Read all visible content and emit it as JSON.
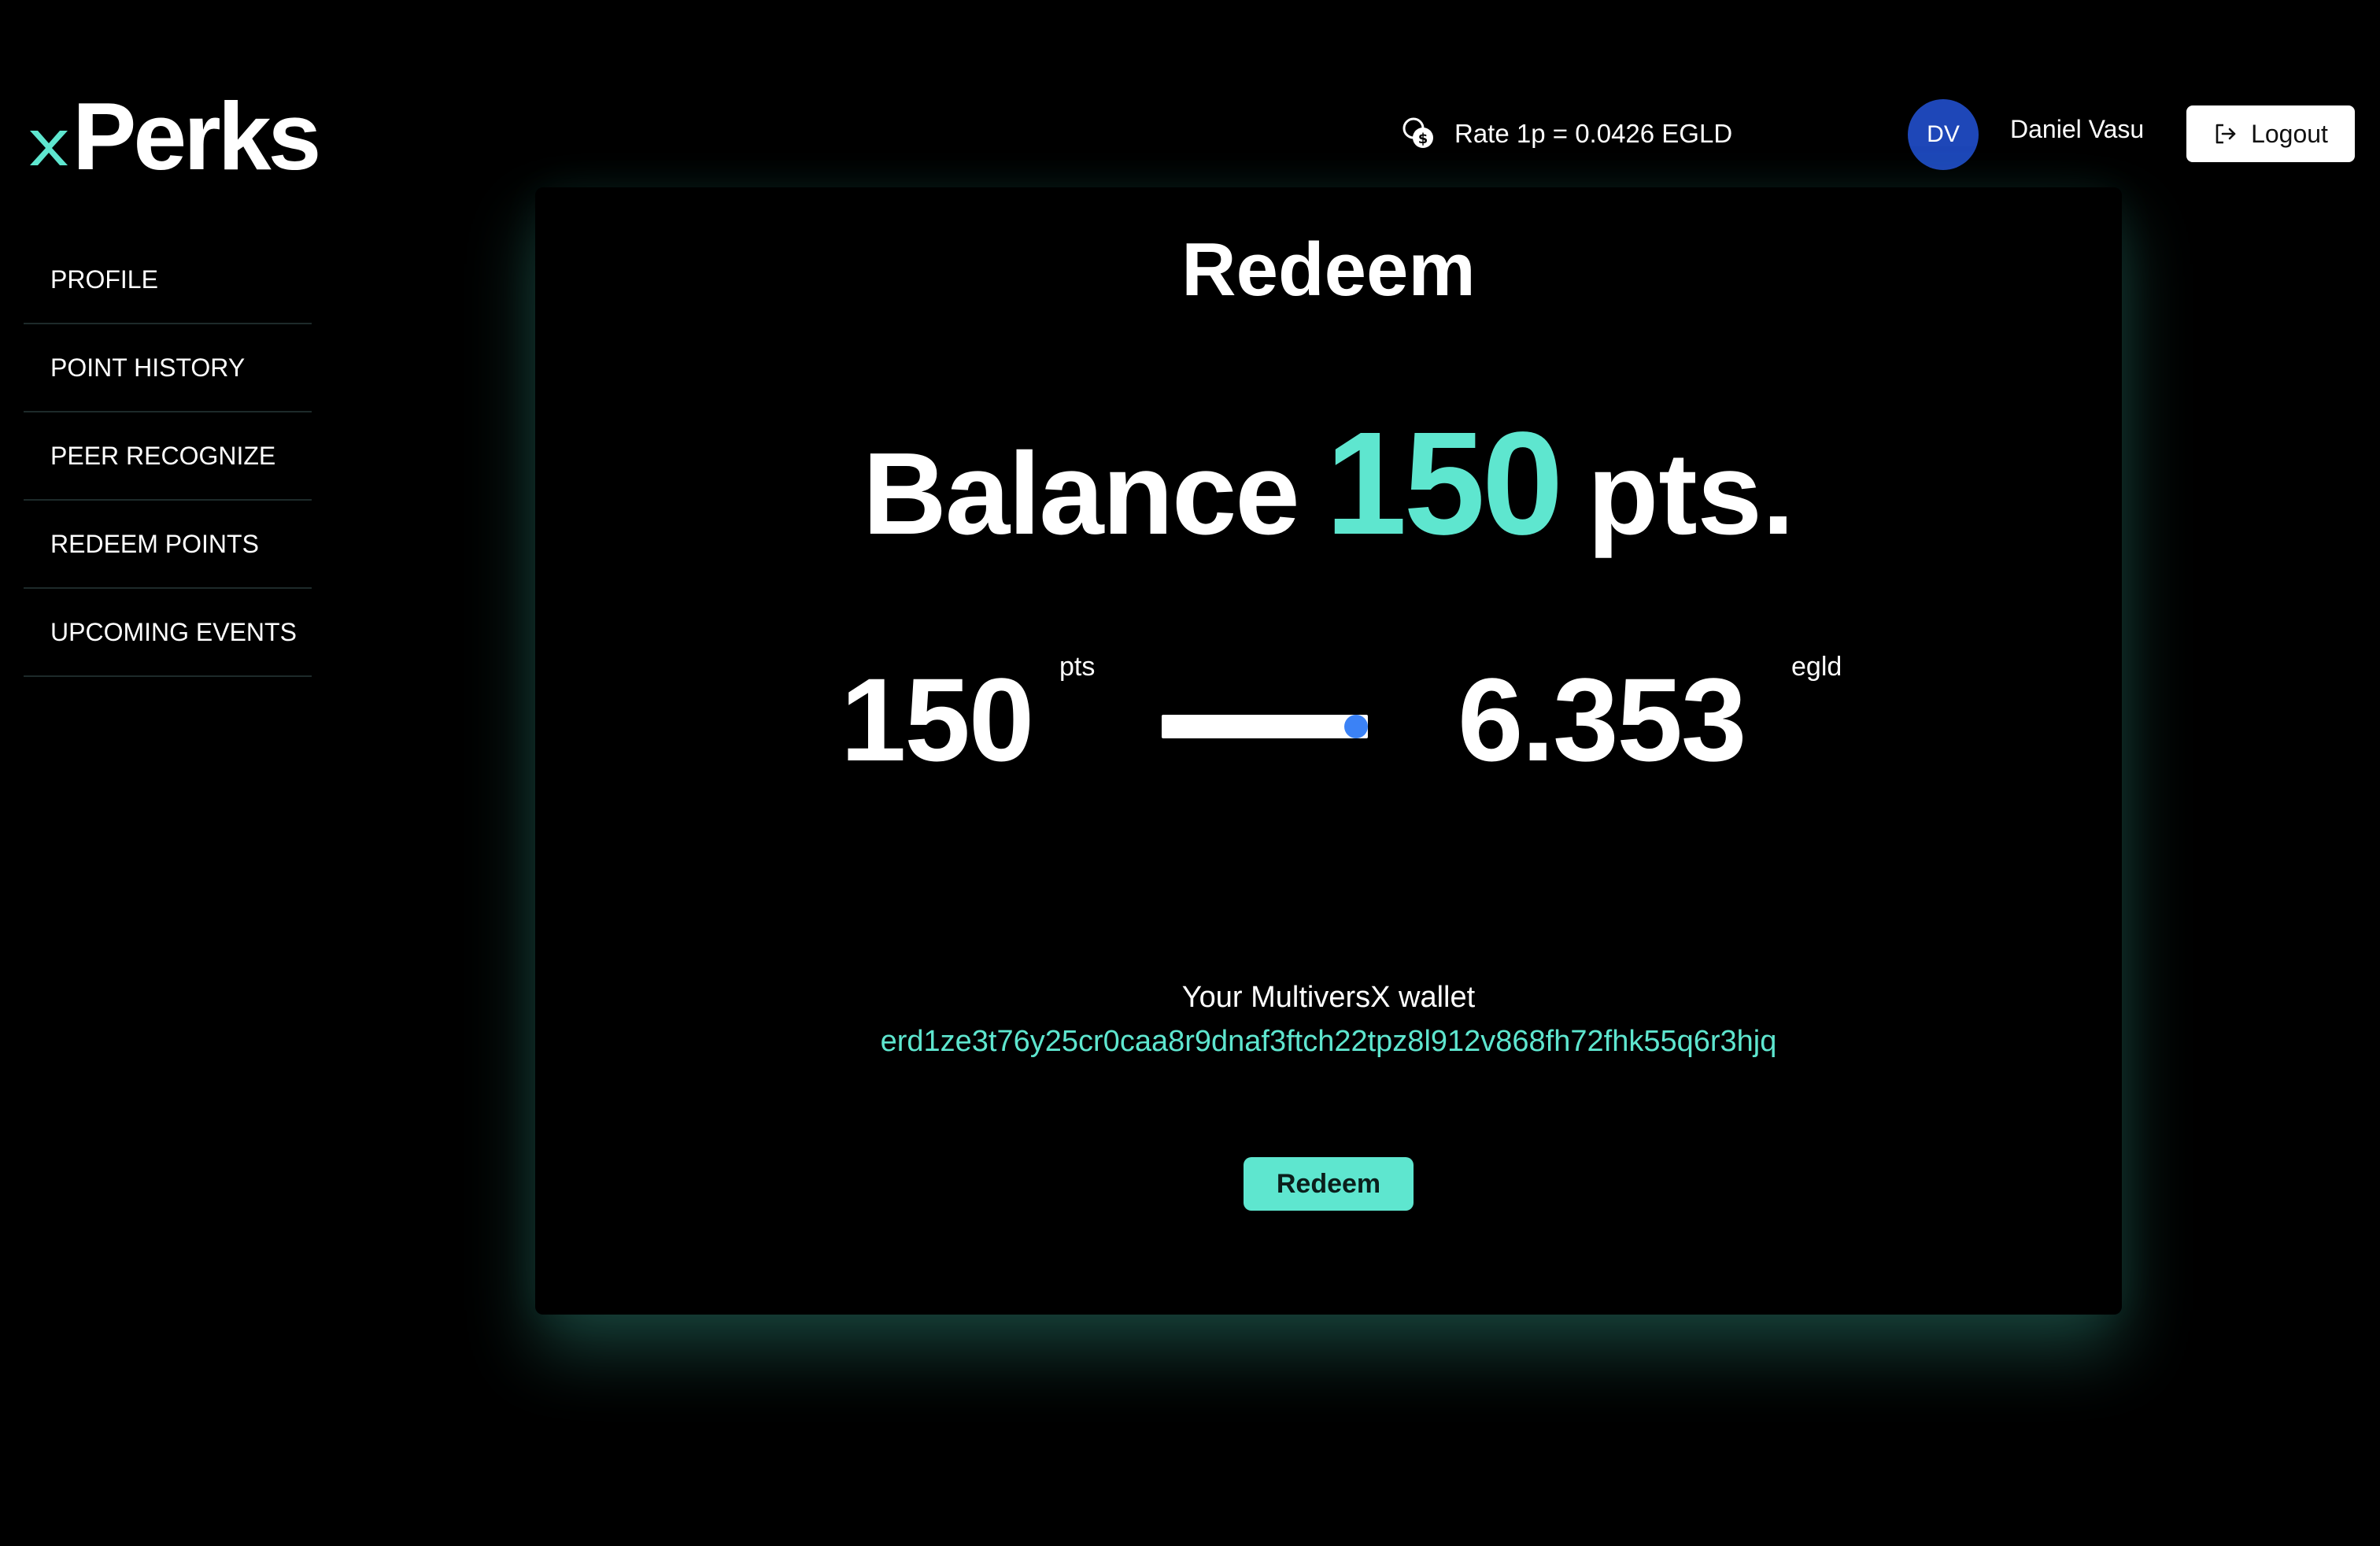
{
  "header": {
    "logo": {
      "prefix": "x",
      "text": "Perks"
    },
    "rate_text": "Rate 1p = 0.0426 EGLD",
    "rate_icon": "coins-icon",
    "user": {
      "initials": "DV",
      "name": "Daniel Vasu"
    },
    "logout_label": "Logout",
    "logout_icon": "logout-icon"
  },
  "sidebar": {
    "items": [
      {
        "label": "PROFILE"
      },
      {
        "label": "POINT HISTORY"
      },
      {
        "label": "PEER RECOGNIZE"
      },
      {
        "label": "REDEEM POINTS"
      },
      {
        "label": "UPCOMING EVENTS"
      }
    ]
  },
  "main": {
    "title": "Redeem",
    "balance": {
      "label": "Balance",
      "value": "150",
      "unit": "pts."
    },
    "converter": {
      "pts_value": "150",
      "pts_unit": "pts",
      "slider_fraction": 1.0,
      "egld_value": "6.353",
      "egld_unit": "egld"
    },
    "wallet_label": "Your MultiversX wallet",
    "wallet_address": "erd1ze3t76y25cr0caa8r9dnaf3ftch22tpz8l912v868fh72fhk55q6r3hjq",
    "redeem_button": "Redeem"
  },
  "colors": {
    "accent": "#5ee6cf",
    "avatar_bg": "#1e47b8",
    "slider_thumb": "#3b82f6",
    "background": "#000000"
  }
}
